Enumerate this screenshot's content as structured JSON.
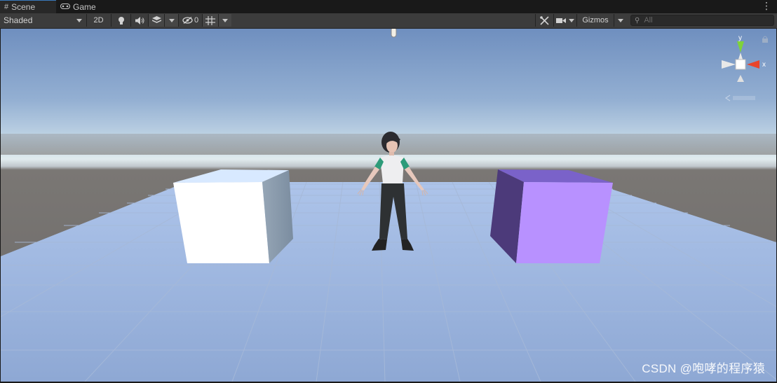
{
  "tabs": [
    {
      "label": "Scene",
      "icon": "grid-icon",
      "active": true
    },
    {
      "label": "Game",
      "icon": "gamepad-icon",
      "active": false
    }
  ],
  "toolbar": {
    "draw_mode": "Shaded",
    "mode_2d_label": "2D",
    "hidden_count": "0",
    "gizmos_label": "Gizmos",
    "search_placeholder": "All"
  },
  "gizmo": {
    "y_label": "y",
    "x_label": "x",
    "colors": {
      "x": "#e8452c",
      "y": "#7fd339",
      "z": "#ffffff"
    }
  },
  "scene": {
    "cube_left_color": "#ffffff",
    "cube_right_color": "#b891ff"
  },
  "watermark": "CSDN @咆哮的程序猿"
}
